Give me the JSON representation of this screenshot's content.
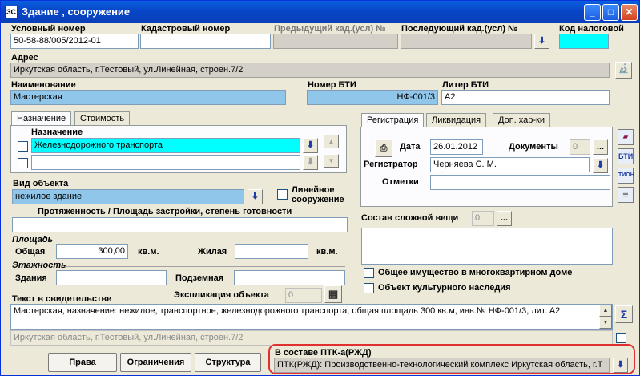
{
  "window": {
    "title": "Здание , сооружение",
    "icon": "app-icon",
    "minimize": "_",
    "maximize": "□",
    "close": "✕"
  },
  "top": {
    "cond_num_label": "Условный номер",
    "cond_num_value": "50-58-88/005/2012-01",
    "cad_num_label": "Кадастровый номер",
    "cad_num_value": "",
    "prev_cad_label": "Предыдущий кад.(усл) №",
    "next_cad_label": "Последующий кад.(усл) №",
    "tax_code_label": "Код налоговой"
  },
  "address": {
    "label": "Адрес",
    "value": "Иркутская область, г.Тестовый, ул.Линейная, строен.7/2"
  },
  "name": {
    "label": "Наименование",
    "value": "Мастерская",
    "bti_label": "Номер БТИ",
    "bti_value": "НФ-001/3",
    "liter_label": "Литер БТИ",
    "liter_value": "А2"
  },
  "left_tabs": {
    "tab1": "Назначение",
    "tab2": "Стоимость",
    "purpose_label": "Назначение",
    "purpose_value1": "Железнодорожного транспорта",
    "purpose_value2": ""
  },
  "object": {
    "kind_label": "Вид объекта",
    "kind_value": "нежилое здание",
    "linear_label_1": "Линейное",
    "linear_label_2": "сооружение",
    "length_label": "Протяженность / Площадь застройки, степень готовности",
    "length_value": ""
  },
  "area": {
    "section_label": "Площадь",
    "total_label": "Общая",
    "total_value": "300,00",
    "unit1": "кв.м.",
    "living_label": "Жилая",
    "living_value": "",
    "unit2": "кв.м."
  },
  "floors": {
    "section_label": "Этажность",
    "buildings_label": "Здания",
    "buildings_value": "",
    "underground_label": "Подземная",
    "underground_value": ""
  },
  "certificate": {
    "label": "Текст в свидетельстве",
    "expl_label": "Экспликация объекта",
    "expl_value": "0",
    "text": "Мастерская, назначение: нежилое, транспортное, железнодорожного транспорта, общая площадь 300 кв.м, инв.№ НФ-001/3, лит. А2",
    "address_text": "Иркутская область, г.Тестовый, ул.Линейная, строен.7/2"
  },
  "right_tabs": {
    "tab1": "Регистрация",
    "tab2": "Ликвидация",
    "tab3": "Доп. хар-ки",
    "date_label": "Дата",
    "date_value": "26.01.2012",
    "docs_label": "Документы",
    "docs_value": "0",
    "registrar_label": "Регистратор",
    "registrar_value": "Черняева С. М.",
    "notes_label": "Отметки",
    "notes_value": ""
  },
  "complex": {
    "label": "Состав сложной вещи",
    "count": "0",
    "common_property_label": "Общее имущество в многоквартирном доме",
    "cultural_label": "Объект культурного наследия"
  },
  "ptk": {
    "label": "В составе ПТК-а(РЖД)",
    "value": "ПТК(РЖД): Производственно-технологический комплекс Иркутская область, г.Т"
  },
  "buttons": {
    "rights": "Права",
    "restrictions": "Ограничения",
    "structure": "Структура",
    "ellipsis": "...",
    "sigma": "Σ",
    "down": "⬇",
    "up": "▲",
    "dn": "▼"
  },
  "side_icons": {
    "bti": "БТИ",
    "tinon": "ТИОН"
  },
  "colors": {
    "accent_cyan": "#00ffff",
    "highlight_blue": "#8fc6ea",
    "title_blue": "#0a5fe0",
    "red_outline": "#e03030"
  }
}
